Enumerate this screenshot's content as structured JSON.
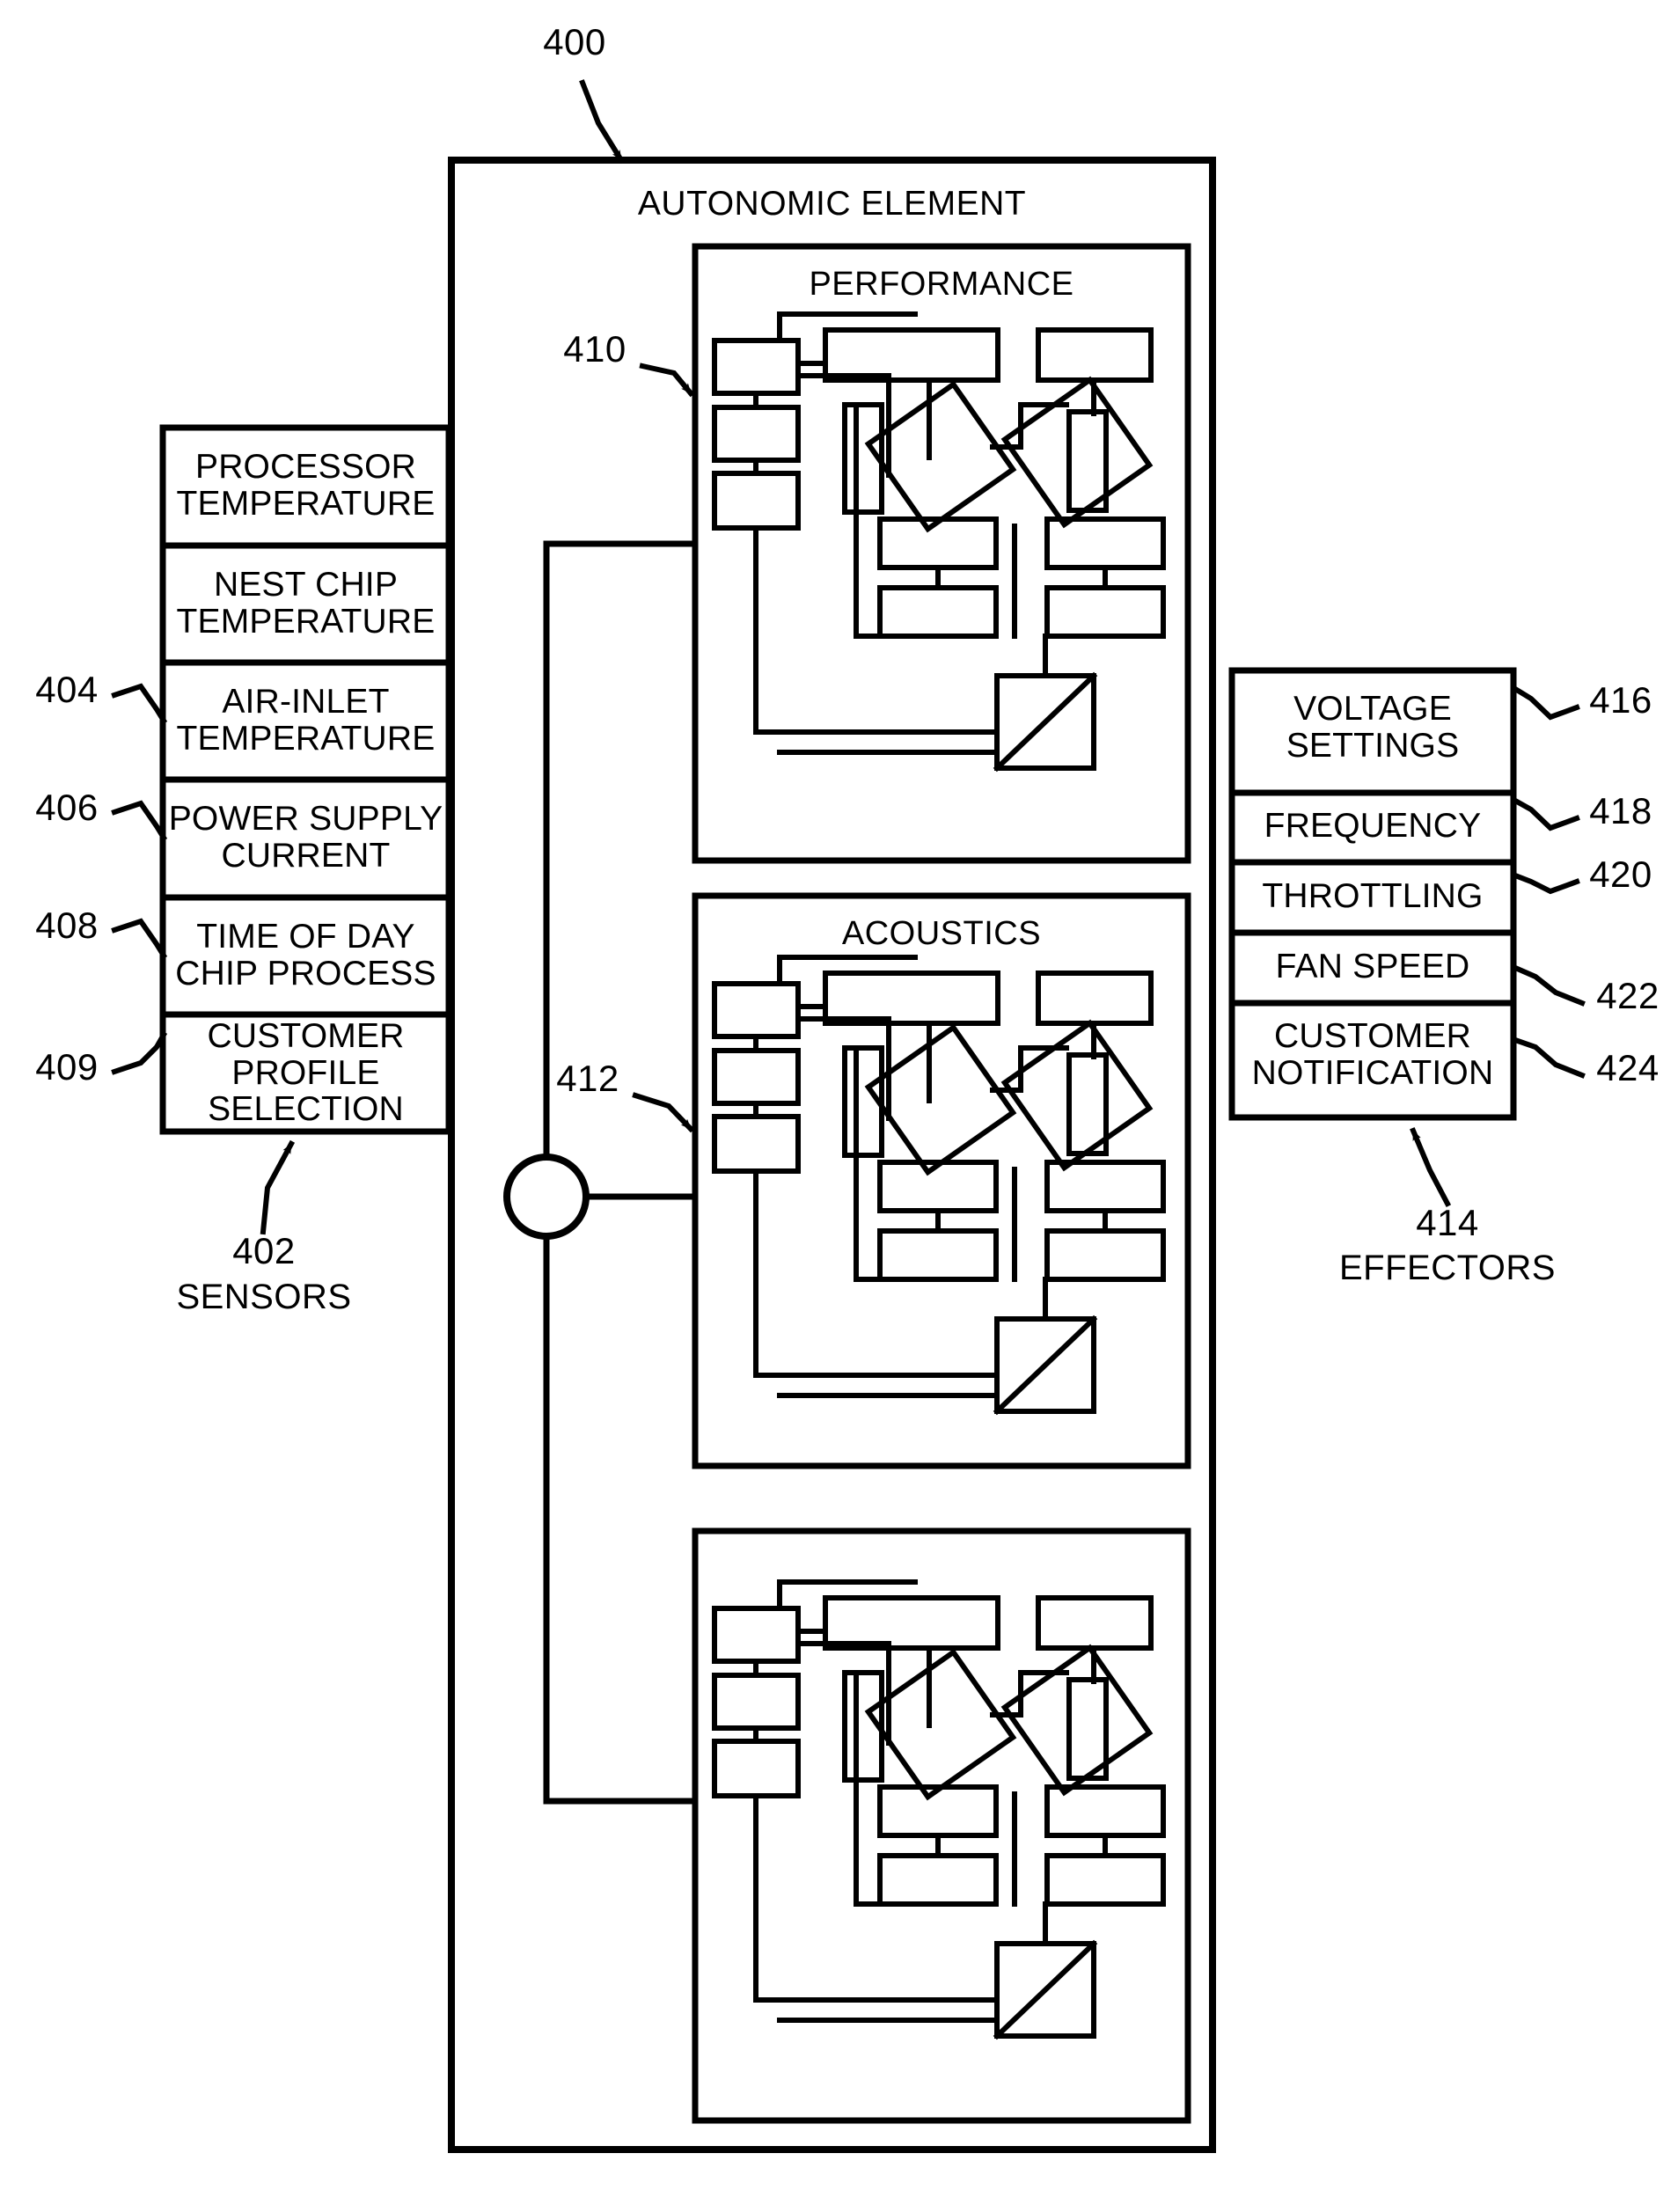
{
  "figure": {
    "main_block": {
      "ref": "400",
      "title": "AUTONOMIC ELEMENT"
    },
    "sensors": {
      "group_ref": "402",
      "group_label": "SENSORS",
      "items": [
        {
          "label": "PROCESSOR\nTEMPERATURE",
          "ref": ""
        },
        {
          "label": "NEST CHIP\nTEMPERATURE",
          "ref": ""
        },
        {
          "label": "AIR-INLET\nTEMPERATURE",
          "ref": "404"
        },
        {
          "label": "POWER SUPPLY\nCURRENT",
          "ref": "406"
        },
        {
          "label": "TIME OF DAY\nCHIP PROCESS",
          "ref": "408"
        },
        {
          "label": "CUSTOMER\nPROFILE\nSELECTION",
          "ref": "409"
        }
      ]
    },
    "effectors": {
      "group_ref": "414",
      "group_label": "EFFECTORS",
      "items": [
        {
          "label": "VOLTAGE\nSETTINGS",
          "ref": "416"
        },
        {
          "label": "FREQUENCY",
          "ref": "418"
        },
        {
          "label": "THROTTLING",
          "ref": "420"
        },
        {
          "label": "FAN SPEED",
          "ref": "422"
        },
        {
          "label": "CUSTOMER\nNOTIFICATION",
          "ref": "424"
        }
      ]
    },
    "subsystems": [
      {
        "title": "PERFORMANCE",
        "ref": "410"
      },
      {
        "title": "ACOUSTICS",
        "ref": "412"
      },
      {
        "title": "",
        "ref": ""
      }
    ],
    "colors": {
      "ink": "#000000",
      "paper": "#ffffff"
    }
  }
}
